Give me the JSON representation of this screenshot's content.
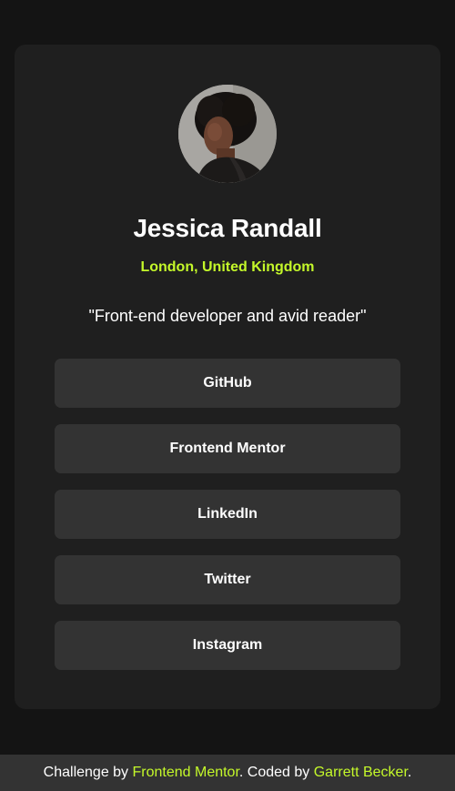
{
  "profile": {
    "name": "Jessica Randall",
    "location": "London, United Kingdom",
    "bio": "\"Front-end developer and avid reader\"",
    "avatar_alt": "profile-photo"
  },
  "links": [
    {
      "label": "GitHub"
    },
    {
      "label": "Frontend Mentor"
    },
    {
      "label": "LinkedIn"
    },
    {
      "label": "Twitter"
    },
    {
      "label": "Instagram"
    }
  ],
  "footer": {
    "prefix": "Challenge by ",
    "challenge_link": "Frontend Mentor",
    "middle": ". Coded by ",
    "author_link": "Garrett Becker",
    "suffix": "."
  },
  "colors": {
    "background": "#141414",
    "card": "#1f1f1f",
    "button": "#333333",
    "accent": "#c4f82a",
    "text": "#ffffff"
  }
}
